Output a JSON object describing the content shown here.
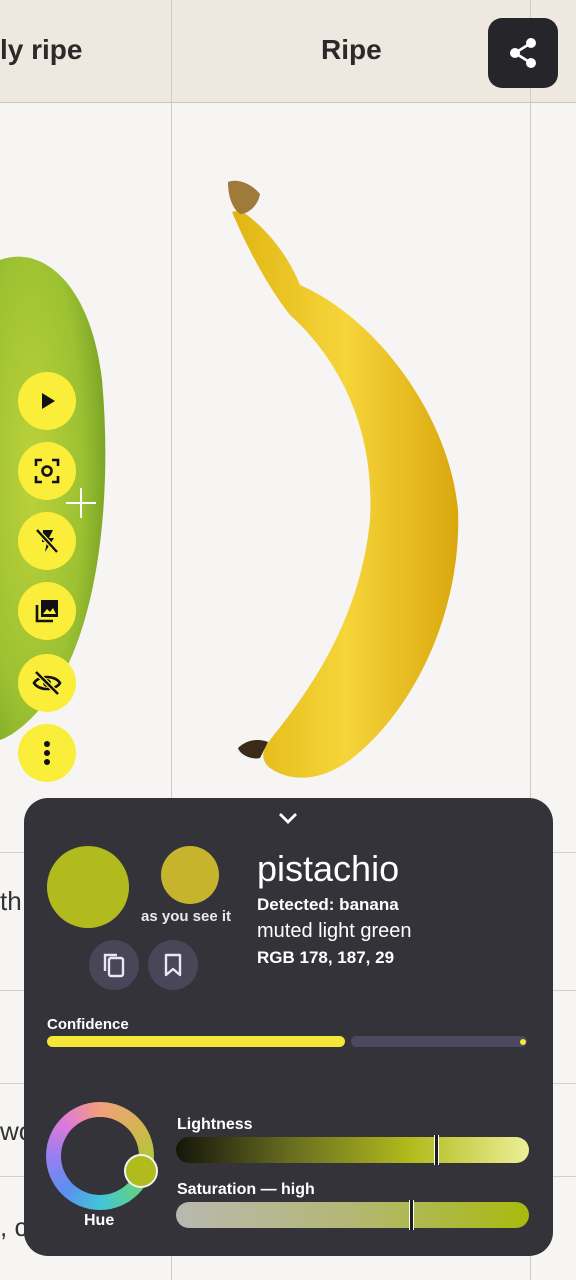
{
  "header": {
    "col_left": "ly ripe",
    "col_right": "Ripe"
  },
  "edge_text": [
    "th",
    "wo",
    ", c"
  ],
  "toolbar": {
    "items": [
      "play-icon",
      "focus-capture-icon",
      "flash-off-icon",
      "gallery-icon",
      "visibility-off-icon",
      "more-vert-icon"
    ]
  },
  "color_panel": {
    "name": "pistachio",
    "detected": "Detected: banana",
    "description": "muted light green",
    "rgb": "RGB 178, 187, 29",
    "seen_label": "as you see it",
    "swatch_color": "#b2bb1d",
    "seen_color": "#c6b52c",
    "confidence_label": "Confidence",
    "confidence": 0.62,
    "hue_label": "Hue",
    "lightness_label": "Lightness",
    "lightness": 0.73,
    "saturation_label": "Saturation — high",
    "saturation": 0.66
  },
  "colors": {
    "accent_yellow": "#fbee3a",
    "panel_bg": "#34333a"
  }
}
